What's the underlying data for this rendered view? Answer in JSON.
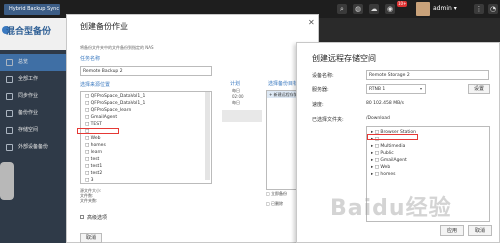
{
  "topbar": {
    "tab_label": "Hybrid Backup Sync",
    "badge": "10+",
    "user": "admin ▾"
  },
  "app": {
    "logo": "混合型备份",
    "nav": [
      "总览",
      "全部工作",
      "同步作业",
      "备份作业",
      "存储空间",
      "外部设备备份"
    ]
  },
  "wizard1": {
    "title": "创建备份作业",
    "description": "将备份文件夹中的文件备份到指定的 NAS",
    "task_name_label": "任务名称",
    "task_name_value": "Remote Backup 2",
    "source_label": "选择来源位置",
    "tree": [
      "□ QFProSpace_DataVol1_1",
      "□ QFProSpace_DataVol1_1",
      "□ QFProSpace_learn",
      "□ GmailAgent",
      "□ TEST",
      "□",
      "□ Web",
      "□ homes",
      "□ learn",
      "□ test",
      "□ test1",
      "□ test2",
      "□ 3"
    ],
    "source_size": "源文件大小:\n文件数:\n文件夹数:",
    "advanced": "高级选项",
    "cancel": "取消",
    "schedule_label": "计划",
    "schedule_text": "每日\n02:00\n每日",
    "dest_label": "选择备份目标",
    "dest_row": "+ 新建远程存储空间",
    "option1": "□ 立即备份",
    "option2": "□ 已删除"
  },
  "wizard2": {
    "title": "创建远程存储空间",
    "name_label": "设备名称:",
    "name_value": "Remote Storage 2",
    "server_label": "服务器:",
    "server_value": "RTNB 1",
    "server_arrow": "▾",
    "set_button": "设置",
    "speed_label": "速度:",
    "speed_value": "80 102.458 MB/s",
    "path_label": "已选择文件夹:",
    "path_value": "/Download",
    "tree": [
      "▸ □ Browser Station",
      "▸ □",
      "▸ □ Multimedia",
      "▸ □ Public",
      "▸ □ GmailAgent",
      "▸ □ Web",
      "▸ □ homes"
    ],
    "apply": "应用",
    "cancel": "取消"
  },
  "watermark": "Baidu经验"
}
